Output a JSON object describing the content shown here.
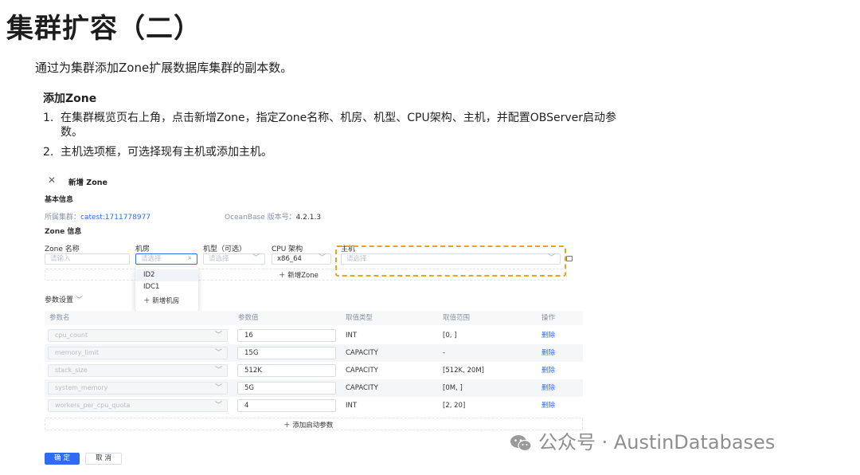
{
  "slide": {
    "title": "集群扩容（二）",
    "intro": "通过为集群添加Zone扩展数据库集群的副本数。",
    "section_heading": "添加Zone",
    "steps": [
      {
        "num": "1.",
        "text": "在集群概览页右上角，点击新增Zone，指定Zone名称、机房、机型、CPU架构、主机，并配置OBServer启动参",
        "cont": "数。"
      },
      {
        "num": "2.",
        "text": "主机选项框，可选择现有主机或添加主机。"
      }
    ]
  },
  "dialog": {
    "close_glyph": "✕",
    "title": "新增 Zone",
    "basic_info_heading": "基本信息",
    "cluster_label": "所属集群：",
    "cluster_value": "catest:1711778977",
    "version_label": "OceanBase 版本号：",
    "version_value": "4.2.1.3",
    "zone_info_heading": "Zone 信息",
    "zone_fields": {
      "zone_name": {
        "label": "Zone 名称",
        "placeholder": "请输入"
      },
      "idc": {
        "label": "机房",
        "placeholder": "请选择"
      },
      "model": {
        "label": "机型（可选）",
        "placeholder": "请选择"
      },
      "cpu": {
        "label": "CPU 架构",
        "value": "x86_64"
      },
      "host": {
        "label": "主机",
        "placeholder": "请选择"
      }
    },
    "idc_dropdown": {
      "options": [
        "ID2",
        "IDC1"
      ],
      "add_label": "新增机房"
    },
    "add_zone_label": "新增Zone",
    "param_settings_label": "参数设置",
    "param_table": {
      "headers": [
        "参数名",
        "参数值",
        "取值类型",
        "取值范围",
        "操作"
      ],
      "rows": [
        {
          "name": "cpu_count",
          "value": "16",
          "type": "INT",
          "range": "[0, ]",
          "action": "删除"
        },
        {
          "name": "memory_limit",
          "value": "15G",
          "type": "CAPACITY",
          "range": "-",
          "action": "删除"
        },
        {
          "name": "stack_size",
          "value": "512K",
          "type": "CAPACITY",
          "range": "[512K, 20M]",
          "action": "删除"
        },
        {
          "name": "system_memory",
          "value": "5G",
          "type": "CAPACITY",
          "range": "[0M, ]",
          "action": "删除"
        },
        {
          "name": "workers_per_cpu_quota",
          "value": "4",
          "type": "INT",
          "range": "[2, 20]",
          "action": "删除"
        }
      ]
    },
    "add_param_label": "添加启动参数",
    "confirm_label": "确 定",
    "cancel_label": "取 消"
  },
  "watermark": {
    "text": "公众号 · AustinDatabases",
    "icon": "wechat-icon"
  },
  "colors": {
    "accent": "#2f6cf5",
    "highlight": "#f0a020"
  }
}
